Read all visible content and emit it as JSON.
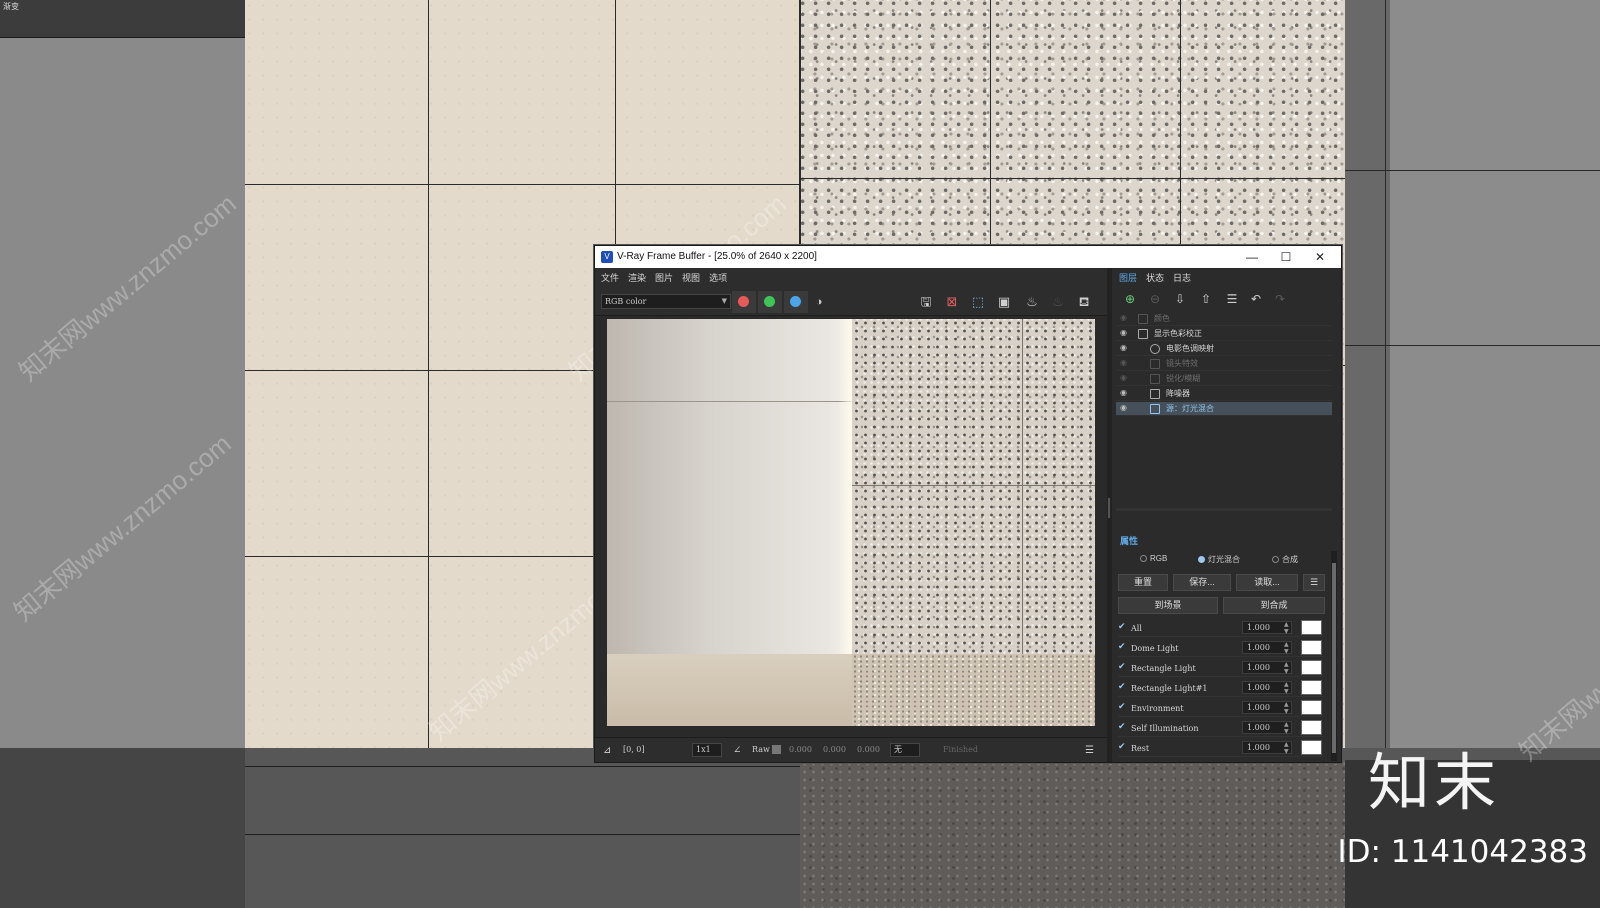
{
  "background": {
    "corner_label": "渐变",
    "watermark_text": "知末网www.znzmo.com",
    "brand_text": "知末",
    "brand_id": "ID: 1141042383"
  },
  "vfb": {
    "title": "V-Ray Frame Buffer - [25.0% of 2640 x 2200]",
    "app_icon": "vray-icon",
    "window_controls": {
      "minimize": "—",
      "maximize": "☐",
      "close": "✕"
    },
    "menu": [
      "文件",
      "渲染",
      "图片",
      "视图",
      "选项"
    ],
    "toolbar": {
      "channel": "RGB color",
      "colors": {
        "red": "#e85a5a",
        "green": "#3fc45a",
        "blue": "#4aa6e8"
      },
      "icons": [
        "save-image-icon",
        "clear-image-icon",
        "region-render-icon",
        "follow-mouse-icon",
        "render-icon",
        "stop-render-icon",
        "render-last-icon"
      ]
    },
    "status": {
      "coords": "[0, 0]",
      "zoom": "1x1",
      "raw_label": "Raw",
      "raw_values": [
        "0.000",
        "0.000",
        "0.000"
      ],
      "mode": "无",
      "state": "Finished"
    },
    "panel": {
      "tabs": [
        "图层",
        "状态",
        "日志"
      ],
      "active_tab": "图层",
      "layers": [
        {
          "label": "颜色",
          "enabled": false
        },
        {
          "label": "显示色彩校正",
          "enabled": true
        },
        {
          "label": "电影色调映射",
          "enabled": true
        },
        {
          "label": "镜头特效",
          "enabled": false
        },
        {
          "label": "锐化/模糊",
          "enabled": false
        },
        {
          "label": "降噪器",
          "enabled": true
        },
        {
          "label": "源：灯光混合",
          "enabled": true,
          "selected": true
        }
      ],
      "properties_title": "属性",
      "modes": [
        "RGB",
        "灯光混合",
        "合成"
      ],
      "active_mode": "灯光混合",
      "buttons": {
        "reset": "重置",
        "save": "保存...",
        "load": "读取...",
        "to_scene": "到场景",
        "to_composite": "到合成"
      },
      "lights": [
        {
          "name": "All",
          "value": "1.000"
        },
        {
          "name": "Dome Light",
          "value": "1.000"
        },
        {
          "name": "Rectangle Light",
          "value": "1.000"
        },
        {
          "name": "Rectangle Light#1",
          "value": "1.000"
        },
        {
          "name": "Environment",
          "value": "1.000"
        },
        {
          "name": "Self Illumination",
          "value": "1.000"
        },
        {
          "name": "Rest",
          "value": "1.000"
        }
      ]
    }
  }
}
